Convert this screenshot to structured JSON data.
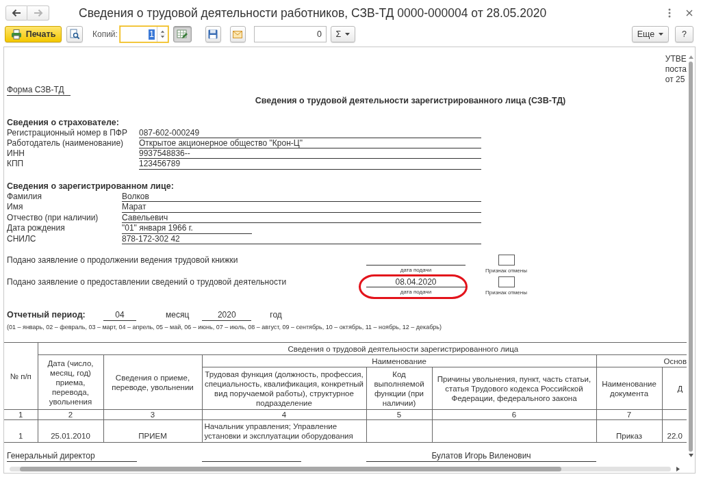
{
  "window": {
    "title": "Сведения о трудовой деятельности работников, СЗВ-ТД 0000-000004 от 28.05.2020",
    "nav": [
      {
        "kind": "back",
        "disabled": false
      },
      {
        "kind": "forward",
        "disabled": true
      }
    ]
  },
  "toolbar": {
    "print": "Печать",
    "copies": {
      "label": "Копий:",
      "value": "1",
      "focused": true
    },
    "edit_toggle": {
      "pressed": true
    },
    "counter": "0",
    "sum": "Σ",
    "more": "Еще",
    "help": "?"
  },
  "document": {
    "corner_note": [
      "УТВЕ",
      "поста",
      "от 25"
    ],
    "form_name": "Форма СЗВ-ТД",
    "title": "Сведения о трудовой деятельности зарегистрированного лица (СЗВ-ТД)",
    "insurer": {
      "heading": "Сведения о страхователе:",
      "fields": [
        {
          "label": "Регистрационный номер в ПФР",
          "value": "087-602-000249"
        },
        {
          "label": "Работодатель (наименование)",
          "value": "Открытое акционерное общество \"Крон-Ц\""
        },
        {
          "label": "ИНН",
          "value": "9937548836--"
        },
        {
          "label": "КПП",
          "value": "123456789"
        }
      ]
    },
    "person": {
      "heading": "Сведения о зарегистрированном лице:",
      "fields": [
        {
          "label": "Фамилия",
          "value": "Волков",
          "kind": "text"
        },
        {
          "label": "Имя",
          "value": "Марат",
          "kind": "text"
        },
        {
          "label": "Отчество (при наличии)",
          "value": "Савельевич",
          "kind": "text"
        },
        {
          "label": "Дата рождения",
          "value": "\"01\" января 1966 г.",
          "kind": "date"
        },
        {
          "label": "СНИЛС",
          "value": "878-172-302 42",
          "kind": "text"
        }
      ]
    },
    "applications": [
      {
        "text": "Подано заявление о продолжении ведения трудовой книжки",
        "date_caption": "дата подачи",
        "cancel_caption": "Признак отмены",
        "cancelled": false,
        "highlighted": false
      },
      {
        "text": "Подано заявление о предоставлении сведений о трудовой деятельности",
        "date": "08.04.2020",
        "date_caption": "дата подачи",
        "cancel_caption": "Признак отмены",
        "cancelled": false,
        "highlighted": true
      }
    ],
    "period": {
      "label": "Отчетный период:",
      "month": "04",
      "month_label": "месяц",
      "year": "2020",
      "year_label": "год",
      "legend": "(01 – январь, 02 – февраль, 03 – март, 04 – апрель, 05 – май, 06 – июнь, 07 – июль, 08 – август, 09 – сентябрь, 10 – октябрь, 11 – ноябрь, 12 – декабрь)"
    },
    "table": {
      "group_header": "Сведения о трудовой деятельности зарегистрированного лица",
      "subgroups": [
        "Наименование",
        "Основ"
      ],
      "columns": [
        "№ п/п",
        "Дата (число, месяц, год) приема, перевода, увольнения",
        "Сведения о приеме, переводе, увольнении",
        "Трудовая функция (должность, профессия, специальность, квалификация, конкретный вид поручаемой работы), структурное подразделение",
        "Код выполняемой функции (при наличии)",
        "Причины увольнения, пункт, часть статьи, статья Трудового кодекса Российской Федерации, федерального закона",
        "Наименование документа",
        "Д"
      ],
      "column_numbers": [
        "1",
        "2",
        "3",
        "4",
        "5",
        "6",
        "7"
      ],
      "rows": [
        {
          "number": "1",
          "date": "25.01.2010",
          "event": "ПРИЕМ",
          "job": "Начальник управления; Управление установки и эксплуатации оборудования",
          "document": "Приказ",
          "column_8": "22.0"
        }
      ]
    },
    "signatures": [
      {
        "kind": "position",
        "value": "Генеральный директор"
      },
      {
        "kind": "signature"
      },
      {
        "kind": "name",
        "value": "Булатов Игорь Виленович"
      }
    ]
  }
}
